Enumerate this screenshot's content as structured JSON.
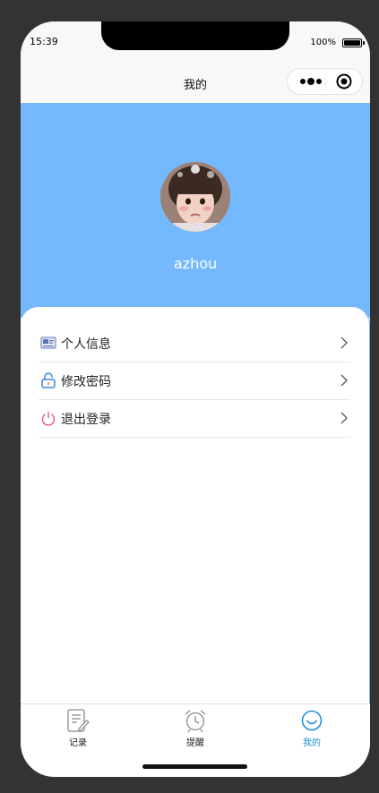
{
  "status_bar": {
    "time": "15:39",
    "battery_percent": "100%",
    "battery_level": 1.0
  },
  "nav": {
    "title": "我的",
    "more_icon": "ellipsis-icon",
    "close_icon": "target-circle-icon"
  },
  "profile": {
    "avatar_icon": "user-photo",
    "username": "azhou",
    "header_color": "#74b9fd"
  },
  "menu": {
    "items": [
      {
        "label": "个人信息",
        "icon": "id-card-icon"
      },
      {
        "label": "修改密码",
        "icon": "lock-icon"
      },
      {
        "label": "退出登录",
        "icon": "power-icon"
      }
    ]
  },
  "tab_bar": {
    "tabs": [
      {
        "label": "记录",
        "icon": "notes-icon",
        "active": false
      },
      {
        "label": "提醒",
        "icon": "alarm-clock-icon",
        "active": false
      },
      {
        "label": "我的",
        "icon": "smile-icon",
        "active": true
      }
    ],
    "active_color": "#1e90d8"
  }
}
